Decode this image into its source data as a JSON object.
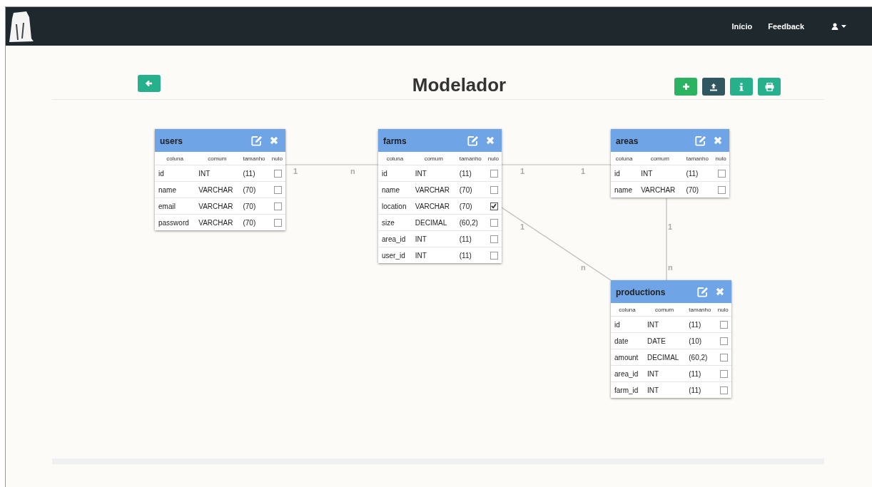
{
  "navbar": {
    "links": [
      "Início",
      "Feedback"
    ]
  },
  "page": {
    "title": "Modelador"
  },
  "tables": [
    {
      "name": "users",
      "headers": [
        "coluna",
        "comum",
        "tamanho",
        "nulo"
      ],
      "columns": [
        {
          "name": "id",
          "type": "INT",
          "size": "(11)",
          "checked": false
        },
        {
          "name": "name",
          "type": "VARCHAR",
          "size": "(70)",
          "checked": false
        },
        {
          "name": "email",
          "type": "VARCHAR",
          "size": "(70)",
          "checked": false
        },
        {
          "name": "password",
          "type": "VARCHAR",
          "size": "(70)",
          "checked": false
        }
      ]
    },
    {
      "name": "farms",
      "headers": [
        "coluna",
        "comum",
        "tamanho",
        "nulo"
      ],
      "columns": [
        {
          "name": "id",
          "type": "INT",
          "size": "(11)",
          "checked": false
        },
        {
          "name": "name",
          "type": "VARCHAR",
          "size": "(70)",
          "checked": false
        },
        {
          "name": "location",
          "type": "VARCHAR",
          "size": "(70)",
          "checked": true
        },
        {
          "name": "size",
          "type": "DECIMAL",
          "size": "(60,2)",
          "checked": false
        },
        {
          "name": "area_id",
          "type": "INT",
          "size": "(11)",
          "checked": false
        },
        {
          "name": "user_id",
          "type": "INT",
          "size": "(11)",
          "checked": false
        }
      ]
    },
    {
      "name": "areas",
      "headers": [
        "coluna",
        "comum",
        "tamanho",
        "nulo"
      ],
      "columns": [
        {
          "name": "id",
          "type": "INT",
          "size": "(11)",
          "checked": false
        },
        {
          "name": "name",
          "type": "VARCHAR",
          "size": "(70)",
          "checked": false
        }
      ]
    },
    {
      "name": "productions",
      "headers": [
        "coluna",
        "comum",
        "tamanho",
        "nulo"
      ],
      "columns": [
        {
          "name": "id",
          "type": "INT",
          "size": "(11)",
          "checked": false
        },
        {
          "name": "date",
          "type": "DATE",
          "size": "(10)",
          "checked": false
        },
        {
          "name": "amount",
          "type": "DECIMAL",
          "size": "(60,2)",
          "checked": false
        },
        {
          "name": "area_id",
          "type": "INT",
          "size": "(11)",
          "checked": false
        },
        {
          "name": "farm_id",
          "type": "INT",
          "size": "(11)",
          "checked": false
        }
      ]
    }
  ],
  "relations": [
    {
      "from_label": "1",
      "to_label": "n"
    },
    {
      "from_label": "1",
      "to_label": "1"
    },
    {
      "from_label": "1",
      "to_label": "n"
    },
    {
      "from_label": "1",
      "to_label": "n"
    }
  ]
}
